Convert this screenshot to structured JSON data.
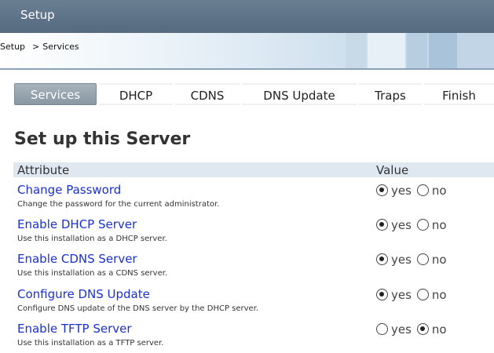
{
  "window": {
    "title": "Setup"
  },
  "breadcrumb": {
    "root": "Setup",
    "separator": ">",
    "current": "Services"
  },
  "tabs": [
    {
      "label": "Services",
      "active": true
    },
    {
      "label": "DHCP",
      "active": false
    },
    {
      "label": "CDNS",
      "active": false
    },
    {
      "label": "DNS Update",
      "active": false
    },
    {
      "label": "Traps",
      "active": false
    },
    {
      "label": "Finish",
      "active": false
    }
  ],
  "page": {
    "heading": "Set up this Server"
  },
  "table": {
    "headers": {
      "attribute": "Attribute",
      "value": "Value"
    },
    "yes_label": "yes",
    "no_label": "no",
    "rows": [
      {
        "name": "Change Password",
        "description": "Change the password for the current administrator.",
        "selected": "yes"
      },
      {
        "name": "Enable DHCP Server",
        "description": "Use this installation as a DHCP server.",
        "selected": "yes"
      },
      {
        "name": "Enable CDNS Server",
        "description": "Use this installation as a CDNS server.",
        "selected": "yes"
      },
      {
        "name": "Configure DNS Update",
        "description": "Configure DNS update of the DNS server by the DHCP server.",
        "selected": "yes"
      },
      {
        "name": "Enable TFTP Server",
        "description": "Use this installation as a TFTP server.",
        "selected": "no"
      }
    ]
  },
  "colors": {
    "titlebar": "#556a7f",
    "active_tab": "#8897a3",
    "link": "#1a2fd6",
    "table_header": "#dfe7f1"
  }
}
